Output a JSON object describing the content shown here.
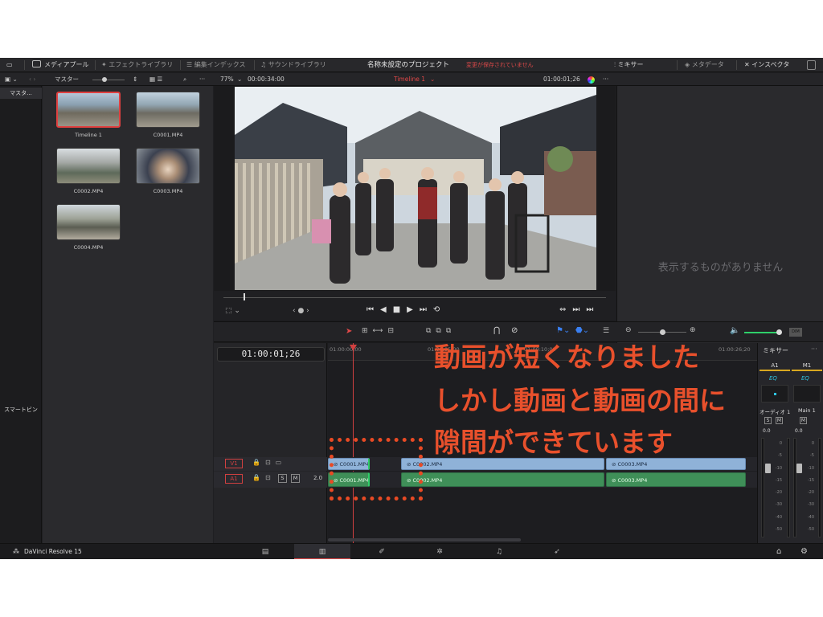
{
  "topbar": {
    "media_pool": "メディアプール",
    "effects_library": "エフェクトライブラリ",
    "edit_index": "編集インデックス",
    "sound_library": "サウンドライブラリ",
    "project_title": "名称未設定のプロジェクト",
    "unsaved_status": "変更が保存されていません",
    "mixer": "ミキサー",
    "metadata": "メタデータ",
    "inspector": "インスペクタ"
  },
  "subbar": {
    "bin_label": "マスター",
    "zoom": "77%",
    "source_timecode": "00:00:34:00",
    "timeline_name": "Timeline 1",
    "record_timecode": "01:00:01;26"
  },
  "sidebar": {
    "master_tab": "マスタ...",
    "smart_bin": "スマートビン"
  },
  "media_pool": {
    "clips": [
      {
        "label": "Timeline 1",
        "selected": true
      },
      {
        "label": "C0001.MP4",
        "selected": false
      },
      {
        "label": "C0002.MP4",
        "selected": false
      },
      {
        "label": "C0003.MP4",
        "selected": false
      },
      {
        "label": "C0004.MP4",
        "selected": false
      }
    ]
  },
  "inspector": {
    "empty_message": "表示するものがありません"
  },
  "timeline": {
    "timecode": "01:00:01;26",
    "ruler_labels": [
      "01:00:00;00",
      "01:00:05;00",
      "01:00:10;00",
      "01:00:26;20"
    ],
    "tracks": {
      "v1": {
        "name": "V1"
      },
      "a1": {
        "name": "A1",
        "level": "2.0",
        "solo": "S",
        "mute": "M"
      }
    },
    "video_clips": [
      "C0001.MP4",
      "C0002.MP4",
      "C0003.MP4"
    ],
    "audio_clips": [
      "C0001.MP4",
      "C0002.MP4",
      "C0003.MP4"
    ]
  },
  "mixer": {
    "title": "ミキサー",
    "channel_a1": "A1",
    "channel_m1": "M1",
    "eq": "EQ",
    "audio1_name": "オーディオ 1",
    "main1_name": "Main 1",
    "level_a1": "0.0",
    "level_main": "0.0",
    "solo": "S",
    "mute": "M",
    "scale": [
      "0",
      "-5",
      "-10",
      "-15",
      "-20",
      "-30",
      "-40",
      "-50"
    ]
  },
  "bottom": {
    "app_name": "DaVinci Resolve 15"
  },
  "annotation": {
    "line1": "動画が短くなりました",
    "line2": "しかし動画と動画の間に",
    "line3": "隙間ができています"
  },
  "colors": {
    "accent_red": "#e04040",
    "annotation_orange": "#e8502c",
    "video_clip": "#8fb2d8",
    "audio_clip": "#3f8f58"
  }
}
